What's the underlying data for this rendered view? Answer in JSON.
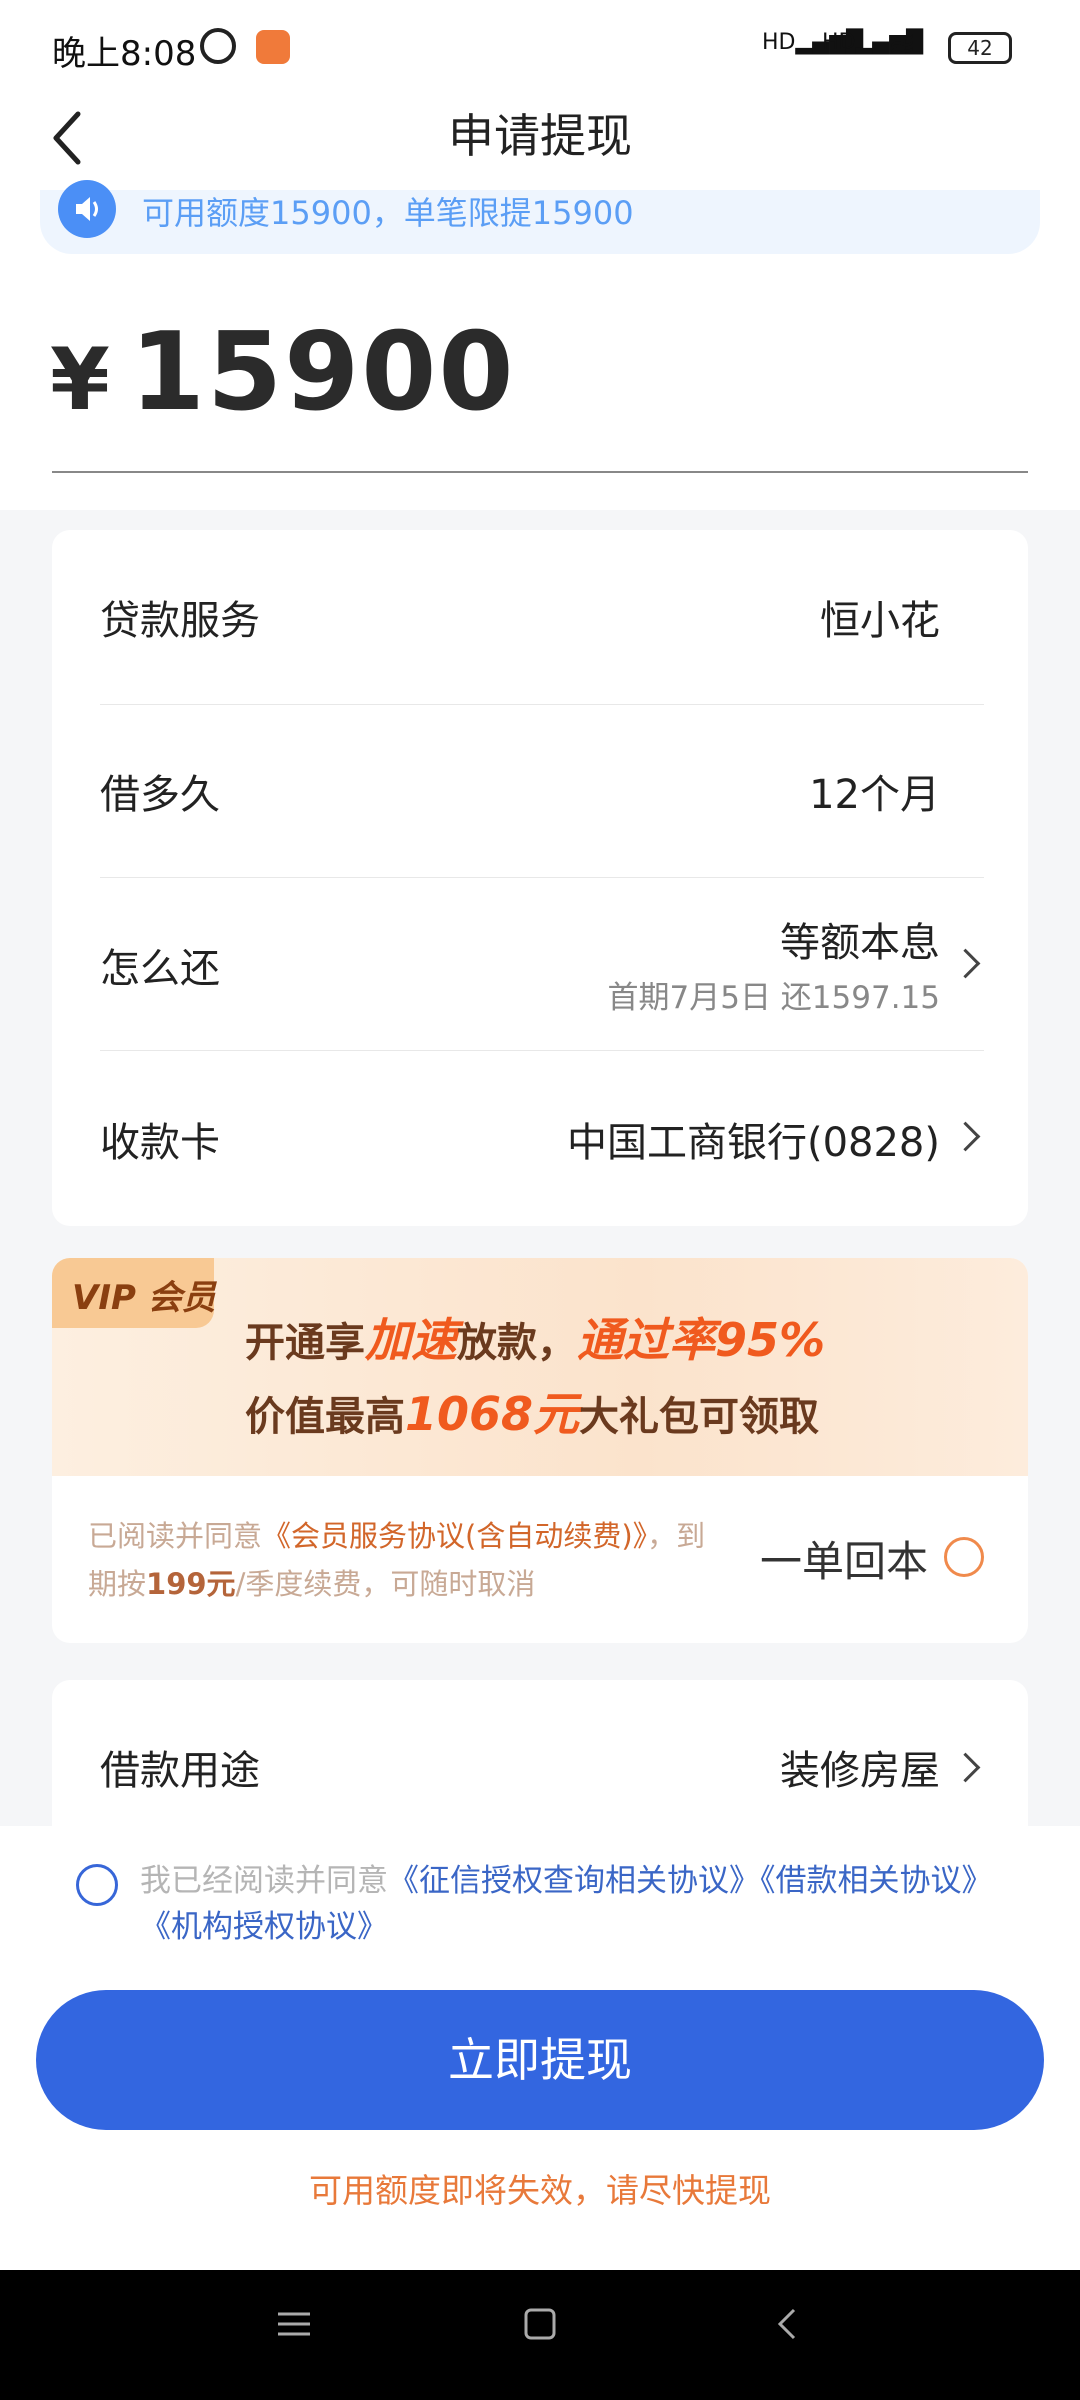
{
  "status_bar": {
    "time": "晚上8:08",
    "signal_1": "HD",
    "signal_2": "HD",
    "battery": "42"
  },
  "header": {
    "title": "申请提现",
    "back_icon": "chevron-left-icon"
  },
  "notice": {
    "text": "可用额度15900，单笔限提15900",
    "icon": "speaker-icon"
  },
  "amount": {
    "currency": "¥",
    "value": "15900"
  },
  "info": {
    "rows": [
      {
        "label": "贷款服务",
        "value": "恒小花"
      },
      {
        "label": "借多久",
        "value": "12个月"
      },
      {
        "label": "怎么还",
        "value": "等额本息",
        "subvalue": "首期7月5日 还1597.15"
      },
      {
        "label": "收款卡",
        "value": "中国工商银行(0828)"
      }
    ]
  },
  "vip": {
    "badge": "VIP 会员",
    "line1_a": "开通享",
    "line1_b": "加速",
    "line1_c": "放款，",
    "line1_d": "通过率95%",
    "line2_a": "价值最高",
    "line2_b": "1068元",
    "line2_c": "大礼包可领取",
    "agree_a": "已阅读并同意",
    "agree_link": "《会员服务协议(含自动续费)》",
    "agree_b": "，到期按",
    "agree_price": "199元",
    "agree_c": "/季度续费，可随时取消",
    "option": "一单回本"
  },
  "purpose": {
    "label": "借款用途",
    "value": "装修房屋"
  },
  "agreement": {
    "prefix": "我已经阅读并同意",
    "link1": "《征信授权查询相关协议》",
    "link2": "《借款相关协议》",
    "link3": "《机构授权协议》"
  },
  "submit_label": "立即提现",
  "expiry_tip": "可用额度即将失效，请尽快提现",
  "colors": {
    "primary": "#3366e0",
    "accent_orange": "#f05a1e",
    "notice_blue": "#5b9ef5"
  }
}
